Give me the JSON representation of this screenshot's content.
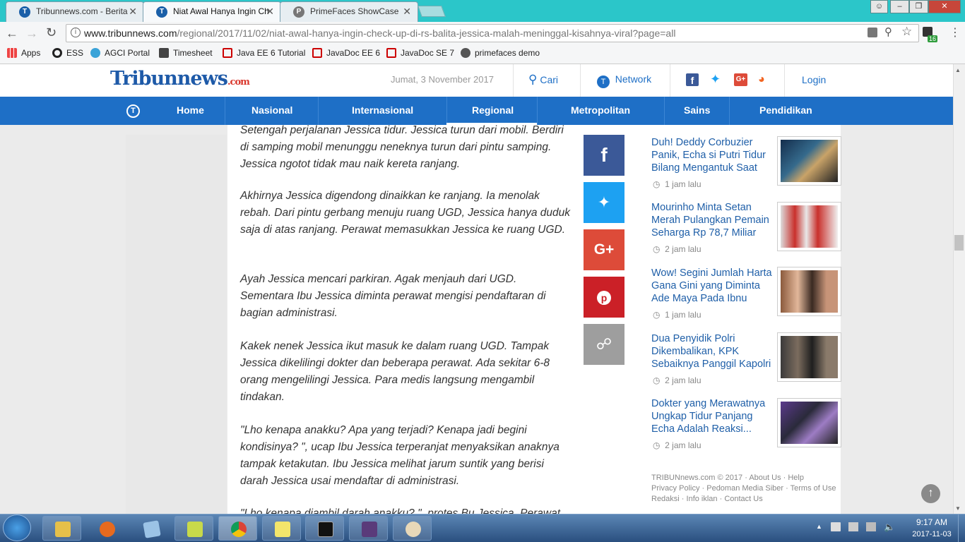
{
  "browser": {
    "tabs": [
      {
        "title": "Tribunnews.com - Berita"
      },
      {
        "title": "Niat Awal Hanya Ingin Ch"
      },
      {
        "title": "PrimeFaces ShowCase"
      }
    ],
    "url_host": "www.tribunnews.com",
    "url_path": "/regional/2017/11/02/niat-awal-hanya-ingin-check-up-di-rs-balita-jessica-malah-meninggal-kisahnya-viral?page=all",
    "extension_badge": "16",
    "bookmarks": [
      "Apps",
      "ESS",
      "AGCI Portal",
      "Timesheet",
      "Java EE 6 Tutorial",
      "JavaDoc EE 6",
      "JavaDoc SE 7",
      "primefaces demo"
    ]
  },
  "site": {
    "logo_text": "Tribunnews",
    "logo_suffix": ".com",
    "date": "Jumat, 3 November 2017",
    "search_label": "Cari",
    "network_label": "Network",
    "login_label": "Login",
    "nav": [
      "Home",
      "Nasional",
      "Internasional",
      "Regional",
      "Metropolitan",
      "Sains",
      "Pendidikan"
    ]
  },
  "article": {
    "paragraphs": [
      "Setengah perjalanan Jessica tidur. Jessica turun dari mobil. Berdiri di samping mobil menunggu neneknya turun dari pintu samping. Jessica ngotot tidak mau naik kereta ranjang.",
      "Akhirnya Jessica digendong dinaikkan ke ranjang. Ia menolak rebah. Dari pintu gerbang menuju ruang UGD, Jessica hanya duduk saja di atas ranjang. Perawat memasukkan Jessica ke ruang UGD.",
      "Ayah Jessica mencari parkiran. Agak menjauh dari UGD. Sementara Ibu Jessica diminta perawat mengisi pendaftaran di bagian administrasi.",
      "Kakek nenek Jessica ikut masuk ke dalam ruang UGD. Tampak Jessica dikelilingi dokter dan beberapa perawat. Ada sekitar 6-8 orang mengelilingi Jessica. Para medis langsung mengambil tindakan.",
      "\"Lho kenapa anakku? Apa yang terjadi? Kenapa jadi begini kondisinya? \", ucap Ibu Jessica terperanjat menyaksikan anaknya tampak ketakutan. Ibu Jessica melihat jarum suntik yang berisi darah Jessica usai mendaftar di administrasi.",
      "\"Lho kenapa diambil darah anakku? \", protes Bu Jessica. Perawat"
    ]
  },
  "sidebar": {
    "items": [
      {
        "title": "Duh! Deddy Corbuzier Panik, Echa si Putri Tidur Bilang Mengantuk Saat",
        "time": "1 jam lalu"
      },
      {
        "title": "Mourinho Minta Setan Merah Pulangkan Pemain Seharga Rp 78,7 Miliar",
        "time": "2 jam lalu"
      },
      {
        "title": "Wow! Segini Jumlah Harta Gana Gini yang Diminta Ade Maya Pada Ibnu",
        "time": "1 jam lalu"
      },
      {
        "title": "Dua Penyidik Polri Dikembalikan, KPK Sebaiknya Panggil Kapolri",
        "time": "2 jam lalu"
      },
      {
        "title": "Dokter yang Merawatnya Ungkap Tidur Panjang Echa Adalah Reaksi...",
        "time": "2 jam lalu"
      }
    ],
    "footer_line1": "TRIBUNnews.com © 2017  ·  About Us  ·  Help",
    "footer_line2": "Privacy Policy  ·  Pedoman Media Siber  ·  Terms of Use",
    "footer_line3": "Redaksi  ·  Info iklan  ·  Contact Us"
  },
  "taskbar": {
    "time": "9:17 AM",
    "date": "2017-11-03"
  },
  "colors": {
    "nav_blue": "#1e6fc6",
    "link_blue": "#1f5fa8",
    "facebook": "#3b5998",
    "twitter": "#1da1f2",
    "googleplus": "#dd4b39",
    "pinterest": "#cb2027",
    "share_gray": "#9e9e9e"
  }
}
